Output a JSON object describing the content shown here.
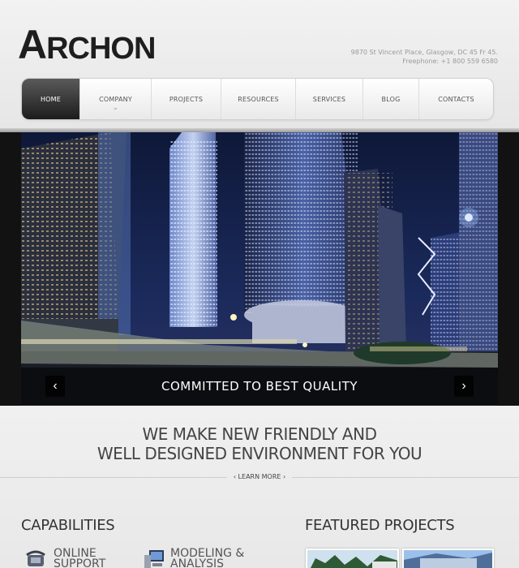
{
  "brand": {
    "logo_first": "A",
    "logo_rest": "RCHON"
  },
  "contact": {
    "address": "9870 St Vincent Place, Glasgow, DC 45 Fr 45.",
    "phone": "Freephone: +1 800 559 6580"
  },
  "nav": {
    "items": [
      {
        "label": "HOME"
      },
      {
        "label": "COMPANY"
      },
      {
        "label": "PROJECTS"
      },
      {
        "label": "RESOURCES"
      },
      {
        "label": "SERVICES"
      },
      {
        "label": "BLOG"
      },
      {
        "label": "CONTACTS"
      }
    ],
    "active": "HOME"
  },
  "slider": {
    "caption": "COMMITTED TO BEST QUALITY",
    "prev_icon": "chevron-left-icon",
    "next_icon": "chevron-right-icon"
  },
  "intro": {
    "line1": "WE MAKE NEW FRIENDLY AND",
    "line2": "WELL DESIGNED ENVIRONMENT FOR YOU",
    "learn_more": "‹ LEARN MORE ›"
  },
  "capabilities": {
    "title": "CAPABILITIES",
    "items": [
      {
        "line1": "ONLINE",
        "line2": "SUPPORT",
        "icon": "phone-icon"
      },
      {
        "line1": "MODELING &",
        "line2": "ANALYSIS",
        "icon": "computer-icon"
      }
    ]
  },
  "featured": {
    "title": "FEATURED PROJECTS"
  },
  "colors": {
    "active_nav": "#2a2a2a",
    "accent_text": "#333333",
    "slider_bg": "#121212"
  }
}
